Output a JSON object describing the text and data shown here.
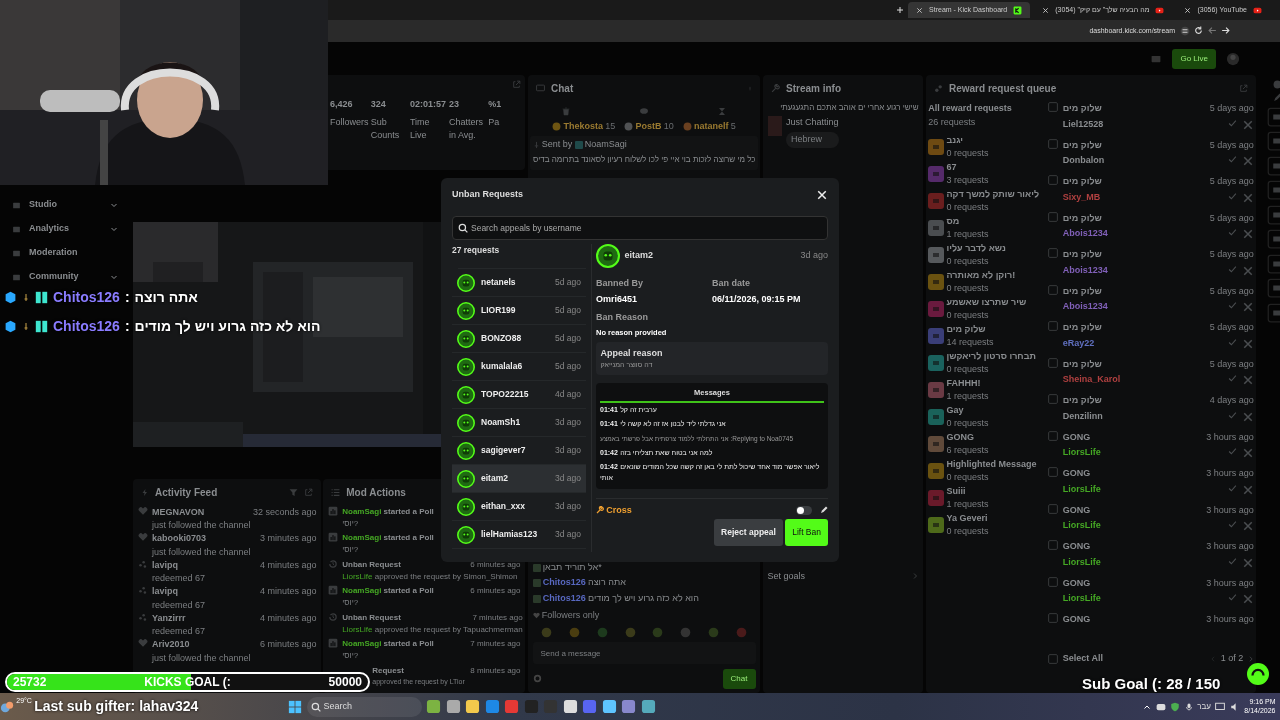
{
  "browser": {
    "tabs": [
      {
        "title": "Stream - Kick Dashboard",
        "selected": true
      },
      {
        "title": "(3054) \"מה הבעיה שלך\" עם קיק",
        "selected": false
      },
      {
        "title": "(3056) YouTube",
        "selected": false
      }
    ],
    "address": "dashboard.kick.com/stream"
  },
  "header": {
    "go_live": "Go Live"
  },
  "sidebar": {
    "items": [
      {
        "label": "Studio",
        "expanded": false
      },
      {
        "label": "Analytics",
        "expanded": false
      },
      {
        "label": "Moderation"
      },
      {
        "label": "Community",
        "expanded": false
      }
    ]
  },
  "stats": [
    {
      "value": "6,426",
      "label": "Followers"
    },
    {
      "value": "324",
      "label": "Sub Counts"
    },
    {
      "value": "02:01:57",
      "label": "Time Live"
    },
    {
      "value": "23",
      "label": "Chatters in Avg."
    },
    {
      "value": "%1",
      "label": "Pa"
    }
  ],
  "chat": {
    "title": "Chat",
    "leaders": [
      {
        "name": "Thekosta",
        "count": "15",
        "color": "#6e5512"
      },
      {
        "name": "PostB",
        "count": "10",
        "color": "#505254"
      },
      {
        "name": "natanelf",
        "count": "5",
        "color": "#6a4020"
      }
    ],
    "pinned": {
      "label": "Sent by",
      "user": "NoamSagi",
      "text": "כל מי שרוצה לזכות בוי איי פי לכו לשלוח רעיון לסאונד בתרומה בדיס"
    },
    "messages": [
      {
        "text": "*אל תוריד תבאן"
      },
      {
        "user": "Chitos126",
        "text": "אתה רוצה"
      },
      {
        "user": "Chitos126",
        "text": "הוא לא כזה גרוע ויש לך מודים"
      }
    ],
    "mode": "Followers only",
    "placeholder": "Send a message",
    "send": "Chat"
  },
  "stream_info": {
    "title": "Stream info",
    "stream_title": "שישי רגוע אחרי ים אוהב אתכם התגעגעתי",
    "category": "Just Chatting",
    "tag": "Hebrew",
    "set_goals": "Set goals"
  },
  "reward_queue": {
    "title": "Reward request queue",
    "all": "All reward requests",
    "all_count": "26 requests",
    "rewards": [
      {
        "name": "יגנב",
        "count": "0 requests",
        "color": "#6e4a12"
      },
      {
        "name": "67",
        "count": "3 requests",
        "color": "#552a6a"
      },
      {
        "name": "ליאור שותק למשך דקה",
        "count": "0 requests",
        "color": "#6a1e1e"
      },
      {
        "name": "מס",
        "count": "1 requests",
        "color": "#4a4d50"
      },
      {
        "name": "נשא לדבר עליו",
        "count": "0 requests",
        "color": "#56595c"
      },
      {
        "name": "רוקן לא מאותרה!",
        "count": "0 requests",
        "color": "#6a5210"
      },
      {
        "name": "שיר שתרצו שאשמע",
        "count": "0 requests",
        "color": "#6a1a3e"
      },
      {
        "name": "שלוק מים",
        "count": "14 requests",
        "color": "#3a3e78"
      },
      {
        "name": "תבחרו סרטון לריאקשן",
        "count": "0 requests",
        "color": "#1a625e"
      },
      {
        "name": "FAHHH!",
        "count": "1 requests",
        "color": "#6a3a44"
      },
      {
        "name": "Gay",
        "count": "0 requests",
        "color": "#1a625a"
      },
      {
        "name": "GONG",
        "count": "6 requests",
        "color": "#604a3a"
      },
      {
        "name": "Highlighted Message",
        "count": "0 requests",
        "color": "#6a5210"
      },
      {
        "name": "Suiii",
        "count": "1 requests",
        "color": "#6a1a2a"
      },
      {
        "name": "Ya Geveri",
        "count": "0 requests",
        "color": "#4e6a1a"
      }
    ],
    "requests": [
      {
        "reward": "שלוק מים",
        "user": "Liel12528",
        "time": "5 days ago",
        "color": "#8a8d90"
      },
      {
        "reward": "שלוק מים",
        "user": "Donbalon",
        "time": "5 days ago",
        "color": "#8a8d90"
      },
      {
        "reward": "שלוק מים",
        "user": "Sixy_MB",
        "time": "5 days ago",
        "color": "#b04040"
      },
      {
        "reward": "שלוק מים",
        "user": "Abois1234",
        "time": "5 days ago",
        "color": "#8060b8"
      },
      {
        "reward": "שלוק מים",
        "user": "Abois1234",
        "time": "5 days ago",
        "color": "#8060b8"
      },
      {
        "reward": "שלוק מים",
        "user": "Abois1234",
        "time": "5 days ago",
        "color": "#8060b8"
      },
      {
        "reward": "שלוק מים",
        "user": "eRay22",
        "time": "5 days ago",
        "color": "#6070c0"
      },
      {
        "reward": "שלוק מים",
        "user": "Sheina_Karol",
        "time": "5 days ago",
        "color": "#b04040"
      },
      {
        "reward": "שלוק מים",
        "user": "Denzilinn",
        "time": "4 days ago",
        "color": "#8a8d90"
      },
      {
        "reward": "GONG",
        "user": "LiorsLife",
        "time": "3 hours ago",
        "color": "#45a824"
      },
      {
        "reward": "GONG",
        "user": "LiorsLife",
        "time": "3 hours ago",
        "color": "#45a824"
      },
      {
        "reward": "GONG",
        "user": "LiorsLife",
        "time": "3 hours ago",
        "color": "#45a824"
      },
      {
        "reward": "GONG",
        "user": "LiorsLife",
        "time": "3 hours ago",
        "color": "#45a824"
      },
      {
        "reward": "GONG",
        "user": "LiorsLife",
        "time": "3 hours ago",
        "color": "#45a824"
      },
      {
        "reward": "GONG",
        "time": "3 hours ago"
      }
    ],
    "select_all": "Select All",
    "page": "1 of 2"
  },
  "activity_feed": {
    "title": "Activity Feed",
    "items": [
      {
        "kind": "follow",
        "user": "MEGNAVON",
        "action": "just followed the channel",
        "time": "32 seconds ago"
      },
      {
        "kind": "follow",
        "user": "kabooki0703",
        "action": "just followed the channel",
        "time": "3 minutes ago"
      },
      {
        "kind": "redeem",
        "user": "lavipq",
        "action": "redeemed 67",
        "time": "4 minutes ago"
      },
      {
        "kind": "redeem",
        "user": "lavipq",
        "action": "redeemed 67",
        "time": "4 minutes ago"
      },
      {
        "kind": "redeem",
        "user": "Yanzirrr",
        "action": "redeemed 67",
        "time": "4 minutes ago"
      },
      {
        "kind": "follow",
        "user": "Ariv2010",
        "action": "just followed the channel",
        "time": "6 minutes ago"
      }
    ]
  },
  "mod_actions": {
    "title": "Mod Actions",
    "items": [
      {
        "kind": "poll",
        "user": "NoamSagi",
        "action": "started a Poll",
        "detail": "יוסי?"
      },
      {
        "kind": "poll",
        "user": "NoamSagi",
        "action": "started a Poll",
        "detail": "יוסי?"
      },
      {
        "kind": "unban",
        "action": "Unban Request",
        "user": "LiorsLife",
        "detail": "approved the request by Simon_Shimon",
        "time": "6 minutes ago"
      },
      {
        "kind": "poll",
        "user": "NoamSagi",
        "action": "started a Poll",
        "detail": "יוסי?",
        "time": "6 minutes ago"
      },
      {
        "kind": "unban",
        "action": "Unban Request",
        "user": "LiorsLife",
        "detail": "approved the request by Tapuachmerman",
        "time": "7 minutes ago"
      },
      {
        "kind": "poll",
        "user": "NoamSagi",
        "action": "started a Poll",
        "detail": "יוסי?",
        "time": "7 minutes ago"
      },
      {
        "kind": "unban_partial",
        "action": "Request",
        "detail": "approved the request by LTior",
        "time": "8 minutes ago"
      }
    ]
  },
  "modal": {
    "title": "Unban Requests",
    "search_placeholder": "Search appeals by username",
    "count": "27 requests",
    "requests": [
      {
        "user": "netanels",
        "time": "5d ago",
        "selected": false
      },
      {
        "user": "LIOR199",
        "time": "5d ago",
        "selected": false
      },
      {
        "user": "BONZO88",
        "time": "5d ago",
        "selected": false
      },
      {
        "user": "kumalala6",
        "time": "5d ago",
        "selected": false
      },
      {
        "user": "TOPO22215",
        "time": "4d ago",
        "selected": false
      },
      {
        "user": "NoamSh1",
        "time": "3d ago",
        "selected": false
      },
      {
        "user": "sagigever7",
        "time": "3d ago",
        "selected": false
      },
      {
        "user": "eitam2",
        "time": "3d ago",
        "selected": true
      },
      {
        "user": "eithan_xxx",
        "time": "3d ago",
        "selected": false
      },
      {
        "user": "lielHamias123",
        "time": "3d ago",
        "selected": false
      }
    ],
    "detail": {
      "user": "eitam2",
      "time": "3d ago",
      "banned_by_label": "Banned By",
      "banned_by": "Omri6451",
      "ban_date_label": "Ban date",
      "ban_date": "06/11/2026, 09:15 PM",
      "reason_label": "Ban Reason",
      "reason": "No reason provided",
      "appeal_label": "Appeal reason",
      "appeal": "דה סווצר המנייאק",
      "messages_tab": "Messages",
      "messages": [
        {
          "kind": "message",
          "time": "01:41",
          "text": "ערבית זה קל"
        },
        {
          "kind": "message",
          "time": "01:41",
          "text": "אני גדלתי ליד לבנון אז זה לא קשה לי"
        },
        {
          "kind": "reply",
          "text": "Replying to Noa0745: אני התחלתי ללמוד צרפתית אבל פרשתי באמצע"
        },
        {
          "kind": "message",
          "time": "01:42",
          "text": "למה אני בטוח שאת תצליחי בזה"
        },
        {
          "kind": "message",
          "time": "01:42",
          "text": "ליאור אפשר מוד אחד שיכול לתת לי באן זה קשה שכל המודים שונאים אותי"
        }
      ],
      "moderator": "Cross",
      "toggle_on": false,
      "reject": "Reject appeal",
      "lift": "Lift Ban"
    }
  },
  "overlay": {
    "separator": ":",
    "chat": [
      {
        "user": "Chitos126",
        "text": "אתה רוצה"
      },
      {
        "user": "Chitos126",
        "text": "הוא לא כזה גרוע ויש לך מודים"
      }
    ],
    "kicks_goal": {
      "current": "25732",
      "label": "KICKS GOAL (:",
      "target": "50000",
      "level": 0.51
    },
    "last_sub_gifter": "Last sub gifter: lahav324",
    "sub_goal": "Sub Goal (: 28 / 150"
  },
  "taskbar": {
    "weather": "29°C",
    "search": "Search",
    "language": "עבר",
    "time": "9:16 PM",
    "date": "8/14/2026"
  }
}
